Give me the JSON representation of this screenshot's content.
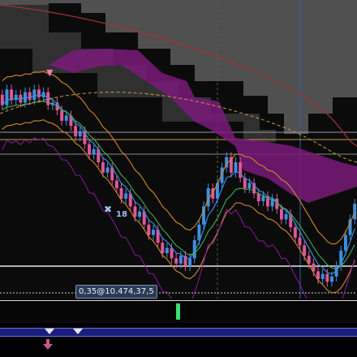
{
  "cursor_readout": "0,35@10.474,37,5",
  "signal_label": "18",
  "colors": {
    "bull_candle": "#3f8fe0",
    "bear_candle": "#e0569a",
    "cloud": "#7a1a7a",
    "upper_band": "#d08a28",
    "ma_fast": "#2f8fe8",
    "ma_mid": "#3fb04f",
    "oscillator": "#8a1a9a",
    "long_ma": "#a83030",
    "volume": "#3fdc6f",
    "signal_band": "#1b1e7a"
  },
  "chart_data": {
    "type": "candlestick",
    "xlabel": "",
    "ylabel": "",
    "grid": true,
    "candles": [
      {
        "o": 76,
        "c": 72
      },
      {
        "o": 72,
        "c": 78
      },
      {
        "o": 78,
        "c": 74
      },
      {
        "o": 74,
        "c": 76
      },
      {
        "o": 76,
        "c": 73
      },
      {
        "o": 73,
        "c": 77
      },
      {
        "o": 77,
        "c": 74
      },
      {
        "o": 74,
        "c": 78
      },
      {
        "o": 78,
        "c": 75
      },
      {
        "o": 75,
        "c": 77
      },
      {
        "o": 77,
        "c": 72
      },
      {
        "o": 72,
        "c": 73
      },
      {
        "o": 73,
        "c": 70
      },
      {
        "o": 70,
        "c": 66
      },
      {
        "o": 66,
        "c": 68
      },
      {
        "o": 68,
        "c": 64
      },
      {
        "o": 64,
        "c": 60
      },
      {
        "o": 60,
        "c": 62
      },
      {
        "o": 62,
        "c": 57
      },
      {
        "o": 57,
        "c": 53
      },
      {
        "o": 53,
        "c": 55
      },
      {
        "o": 55,
        "c": 50
      },
      {
        "o": 50,
        "c": 46
      },
      {
        "o": 46,
        "c": 48
      },
      {
        "o": 48,
        "c": 43
      },
      {
        "o": 43,
        "c": 40
      },
      {
        "o": 40,
        "c": 36
      },
      {
        "o": 36,
        "c": 38
      },
      {
        "o": 38,
        "c": 33
      },
      {
        "o": 33,
        "c": 29
      },
      {
        "o": 29,
        "c": 31
      },
      {
        "o": 31,
        "c": 26
      },
      {
        "o": 26,
        "c": 22
      },
      {
        "o": 22,
        "c": 24
      },
      {
        "o": 24,
        "c": 19
      },
      {
        "o": 19,
        "c": 15
      },
      {
        "o": 15,
        "c": 17
      },
      {
        "o": 17,
        "c": 13
      },
      {
        "o": 13,
        "c": 11
      },
      {
        "o": 11,
        "c": 14
      },
      {
        "o": 14,
        "c": 10
      },
      {
        "o": 10,
        "c": 13
      },
      {
        "o": 13,
        "c": 20
      },
      {
        "o": 20,
        "c": 26
      },
      {
        "o": 26,
        "c": 33
      },
      {
        "o": 33,
        "c": 40
      },
      {
        "o": 40,
        "c": 36
      },
      {
        "o": 36,
        "c": 42
      },
      {
        "o": 42,
        "c": 48
      },
      {
        "o": 48,
        "c": 52
      },
      {
        "o": 52,
        "c": 46
      },
      {
        "o": 46,
        "c": 50
      },
      {
        "o": 50,
        "c": 44
      },
      {
        "o": 44,
        "c": 40
      },
      {
        "o": 40,
        "c": 42
      },
      {
        "o": 42,
        "c": 38
      },
      {
        "o": 38,
        "c": 35
      },
      {
        "o": 35,
        "c": 37
      },
      {
        "o": 37,
        "c": 33
      },
      {
        "o": 33,
        "c": 36
      },
      {
        "o": 36,
        "c": 32
      },
      {
        "o": 32,
        "c": 28
      },
      {
        "o": 28,
        "c": 30
      },
      {
        "o": 30,
        "c": 25
      },
      {
        "o": 25,
        "c": 21
      },
      {
        "o": 21,
        "c": 18
      },
      {
        "o": 18,
        "c": 14
      },
      {
        "o": 14,
        "c": 11
      },
      {
        "o": 11,
        "c": 8
      },
      {
        "o": 8,
        "c": 5
      },
      {
        "o": 5,
        "c": 7
      },
      {
        "o": 7,
        "c": 4
      },
      {
        "o": 4,
        "c": 6
      },
      {
        "o": 6,
        "c": 10
      },
      {
        "o": 10,
        "c": 16
      },
      {
        "o": 16,
        "c": 22
      },
      {
        "o": 22,
        "c": 28
      },
      {
        "o": 28,
        "c": 34
      }
    ],
    "ylim": [
      0,
      100
    ]
  }
}
